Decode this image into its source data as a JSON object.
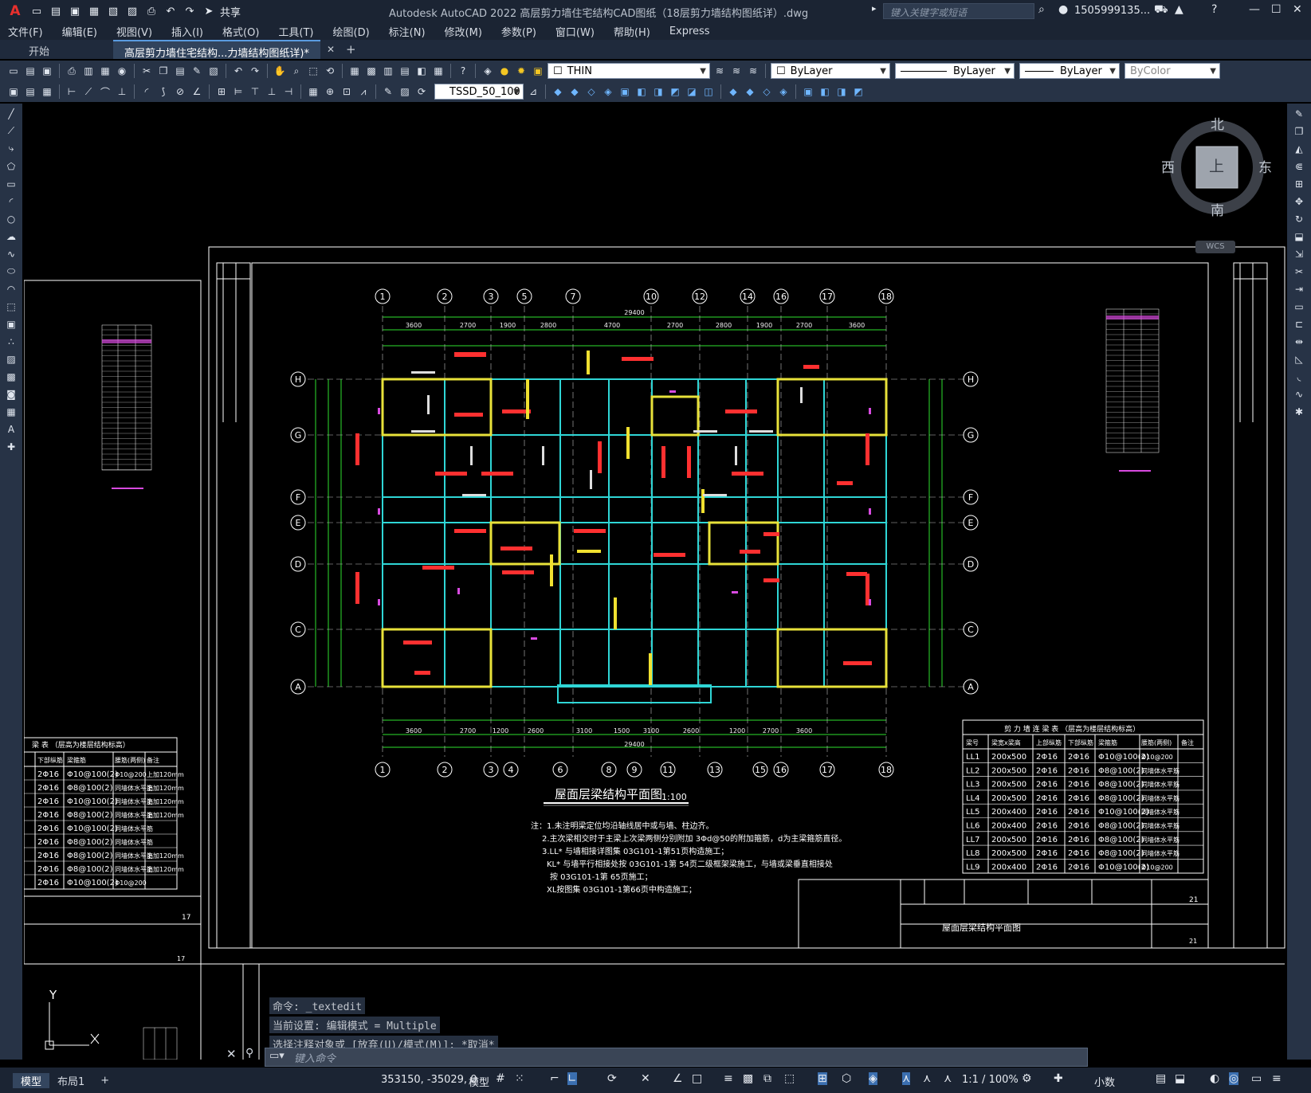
{
  "app": {
    "title": "Autodesk AutoCAD 2022    高层剪力墙住宅结构CAD图纸（18层剪力墙结构图纸详）.dwg",
    "logo": "A",
    "share": "共享",
    "search_placeholder": "键入关键字或短语",
    "user": "1505999135...",
    "help": "?"
  },
  "menu": [
    "文件(F)",
    "编辑(E)",
    "视图(V)",
    "插入(I)",
    "格式(O)",
    "工具(T)",
    "绘图(D)",
    "标注(N)",
    "修改(M)",
    "参数(P)",
    "窗口(W)",
    "帮助(H)",
    "Express"
  ],
  "tabs": {
    "start": "开始",
    "doc": "高层剪力墙住宅结构...力墙结构图纸详)*",
    "add": "+"
  },
  "toolbar": {
    "layer": "THIN",
    "color": "ByLayer",
    "linetype": "ByLayer",
    "lineweight": "ByLayer",
    "plotstyle": "ByColor",
    "dimstyle": "TSSD_50_100"
  },
  "viewcube": {
    "n": "北",
    "s": "南",
    "e": "东",
    "w": "西",
    "top": "上",
    "wcs": "WCS"
  },
  "drawing": {
    "title": "屋面层梁结构平面图",
    "scale": "1:100",
    "axes_top": [
      "1",
      "2",
      "3",
      "5",
      "7",
      "10",
      "12",
      "14",
      "16",
      "17",
      "18"
    ],
    "axes_bottom": [
      "1",
      "2",
      "3",
      "4",
      "6",
      "8",
      "9",
      "11",
      "13",
      "15",
      "16",
      "17",
      "18"
    ],
    "axes_side": [
      "H",
      "G",
      "F",
      "E",
      "D",
      "C",
      "A"
    ],
    "total_dim": "29400",
    "top_dims": [
      "3600",
      "2700",
      "1900",
      "2800",
      "4700",
      "2700",
      "2800",
      "1900",
      "2700",
      "3600"
    ],
    "bottom_dims": [
      "3600",
      "2700",
      "1200",
      "2600",
      "3100",
      "1500",
      "3100",
      "2600",
      "1200",
      "2700",
      "3600"
    ],
    "notes": [
      "注：1.未注明梁定位均沿轴线居中或与墙、柱边齐。",
      "2.主次梁相交时于主梁上次梁两侧分别附加 3Φd@50的附加箍筋，d为主梁箍筋直径。",
      "3.LL* 与墙相接详图集 03G101-1第51页构造施工；",
      "KL* 与墙平行相接处按 03G101-1第 54页二级框架梁施工，与墙或梁垂直相接处",
      "按 03G101-1第 65页施工；",
      "XL按图集 03G101-1第66页中构造施工；"
    ],
    "table_title": "剪 力 墙 连 梁 表  （层高为楼层结构标高）",
    "table_headers": [
      "梁号",
      "梁宽x梁高",
      "上部纵筋",
      "下部纵筋",
      "梁箍筋",
      "腰筋(两侧)",
      "备注"
    ],
    "table_rows": [
      [
        "LL1",
        "200x500",
        "2Φ16",
        "2Φ16",
        "Φ10@100(2)",
        "Φ10@200",
        ""
      ],
      [
        "LL2",
        "200x500",
        "2Φ16",
        "2Φ16",
        "Φ8@100(2)",
        "同墙体水平筋",
        ""
      ],
      [
        "LL3",
        "200x500",
        "2Φ16",
        "2Φ16",
        "Φ8@100(2)",
        "同墙体水平筋",
        ""
      ],
      [
        "LL4",
        "200x500",
        "2Φ16",
        "2Φ16",
        "Φ8@100(2)",
        "同墙体水平筋",
        ""
      ],
      [
        "LL5",
        "200x400",
        "2Φ16",
        "2Φ16",
        "Φ10@100(2)",
        "同墙体水平筋",
        ""
      ],
      [
        "LL6",
        "200x400",
        "2Φ16",
        "2Φ16",
        "Φ8@100(2)",
        "同墙体水平筋",
        ""
      ],
      [
        "LL7",
        "200x500",
        "2Φ16",
        "2Φ16",
        "Φ8@100(2)",
        "同墙体水平筋",
        ""
      ],
      [
        "LL8",
        "200x500",
        "2Φ16",
        "2Φ16",
        "Φ8@100(2)",
        "同墙体水平筋",
        ""
      ],
      [
        "LL9",
        "200x400",
        "2Φ16",
        "2Φ16",
        "Φ10@100(2)",
        "Φ10@200",
        ""
      ]
    ],
    "left_table_title": "梁 表  （层高为楼层结构标高）",
    "left_table_headers": [
      "下部纵筋",
      "梁箍筋",
      "腰筋(两侧)",
      "备注"
    ],
    "left_table_rows": [
      [
        "2Φ16",
        "Φ10@100(2)",
        "Φ10@200",
        "上加120mm"
      ],
      [
        "2Φ16",
        "Φ8@100(2)",
        "同墙体水平筋",
        "上加120mm"
      ],
      [
        "2Φ16",
        "Φ10@100(2)",
        "同墙体水平筋",
        "上加120mm"
      ],
      [
        "2Φ16",
        "Φ8@100(2)",
        "同墙体水平筋",
        "上加120mm"
      ],
      [
        "2Φ16",
        "Φ10@100(2)",
        "同墙体水平筋",
        ""
      ],
      [
        "2Φ16",
        "Φ8@100(2)",
        "同墙体水平筋",
        ""
      ],
      [
        "2Φ16",
        "Φ8@100(2)",
        "同墙体水平筋",
        "上加120mm"
      ],
      [
        "2Φ16",
        "Φ8@100(2)",
        "同墙体水平筋",
        "上加120mm"
      ],
      [
        "2Φ16",
        "Φ10@100(2)",
        "Φ10@200",
        ""
      ]
    ],
    "title_block_name": "屋面层梁结构平面图",
    "sheet_no": "21",
    "left_sheet_no": "17",
    "ucs_y": "Y"
  },
  "command": {
    "history": [
      "命令: _textedit",
      "当前设置: 编辑模式 = Multiple",
      "选择注释对象或 [放弃(U)/模式(M)]: *取消*"
    ],
    "placeholder": "键入命令"
  },
  "status": {
    "tab_model": "模型",
    "tab_layout": "布局1",
    "add": "+",
    "coords": "353150, -35029, 0",
    "model": "模型",
    "scale": "1:1 / 100%",
    "units": "小数"
  }
}
